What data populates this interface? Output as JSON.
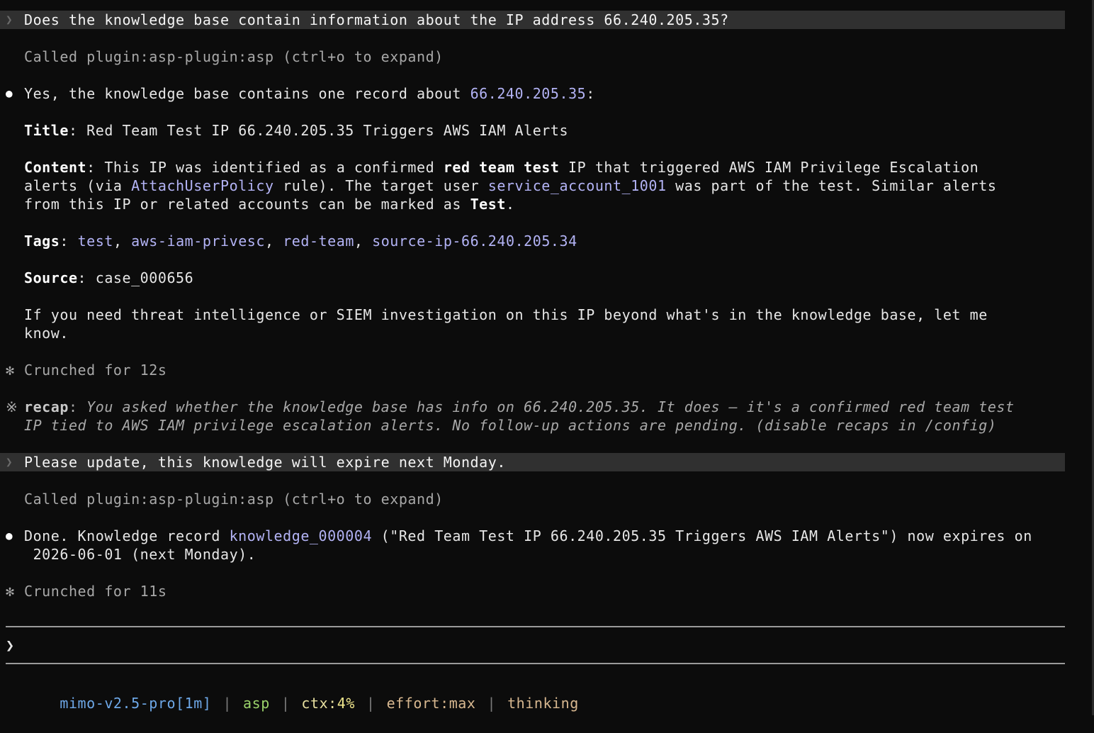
{
  "colors": {
    "background": "#0c0c0c",
    "prompt_band": "#303030",
    "link": "#b3b3f5",
    "model": "#6ea8e8",
    "plugin": "#9bd36b",
    "ctx_label": "#e8e0a0",
    "ctx_value": "#f0e68c",
    "effort": "#d8b890",
    "thinking": "#d8b890"
  },
  "icons": {
    "prompt_marker": "chevron-right-icon",
    "bullet": "bullet-icon",
    "crunch": "asterisk-icon",
    "recap": "reference-mark-icon",
    "input_caret": "chevron-right-icon"
  },
  "glyphs": {
    "prompt": "❯",
    "bullet": "●",
    "crunch": "✻",
    "recap": "※",
    "caret": "❯"
  },
  "conversation": {
    "q1": "Does the knowledge base contain information about the IP address 66.240.205.35?",
    "tool_call_1": "Called plugin:asp-plugin:asp (ctrl+o to expand)",
    "answer1": {
      "intro": "Yes, the knowledge base contains one record about ",
      "ip": "66.240.205.35",
      "colon": ":",
      "title_label": "Title",
      "title_value": ": Red Team Test IP 66.240.205.35 Triggers AWS IAM Alerts",
      "content_label": "Content",
      "content_a": ": This IP was identified as a confirmed ",
      "content_b": "red team test",
      "content_c": " IP that triggered AWS IAM Privilege Escalation",
      "content2_a": "alerts (via ",
      "content2_b": "AttachUserPolicy",
      "content2_c": " rule). The target user ",
      "content2_d": "service_account_1001",
      "content2_e": " was part of the test. Similar alerts",
      "content3_a": "from this IP or related accounts can be marked as ",
      "content3_b": "Test",
      "content3_c": ".",
      "tags_label": "Tags",
      "tags_colon": ": ",
      "tags": [
        "test",
        "aws-iam-privesc",
        "red-team",
        "source-ip-66.240.205.34"
      ],
      "tags_sep": ", ",
      "source_label": "Source",
      "source_value": ": case_000656",
      "closing_1": "If you need threat intelligence or SIEM investigation on this IP beyond what's in the knowledge base, let me",
      "closing_2": "know."
    },
    "crunch_1": "Crunched for 12s",
    "recap": {
      "label": "recap",
      "colon": ":",
      "line1": " You asked whether the knowledge base has info on 66.240.205.35. It does — it's a confirmed red team test",
      "line2": "IP tied to AWS IAM privilege escalation alerts. No follow-up actions are pending. (disable recaps in /config)"
    },
    "q2": "Please update, this knowledge will expire next Monday.",
    "tool_call_2": "Called plugin:asp-plugin:asp (ctrl+o to expand)",
    "answer2": {
      "a": "Done. Knowledge record ",
      "record": "knowledge_000004",
      "b": " (\"Red Team Test IP 66.240.205.35 Triggers AWS IAM Alerts\") now expires on",
      "line2": " 2026-06-01 (next Monday)."
    },
    "crunch_2": "Crunched for 11s"
  },
  "status_bar": {
    "model": "mimo-v2.5-pro[1m]",
    "plugin": "asp",
    "ctx_label": "ctx:",
    "ctx_value": "4%",
    "effort": "effort:max",
    "thinking": "thinking",
    "separator": "|"
  }
}
